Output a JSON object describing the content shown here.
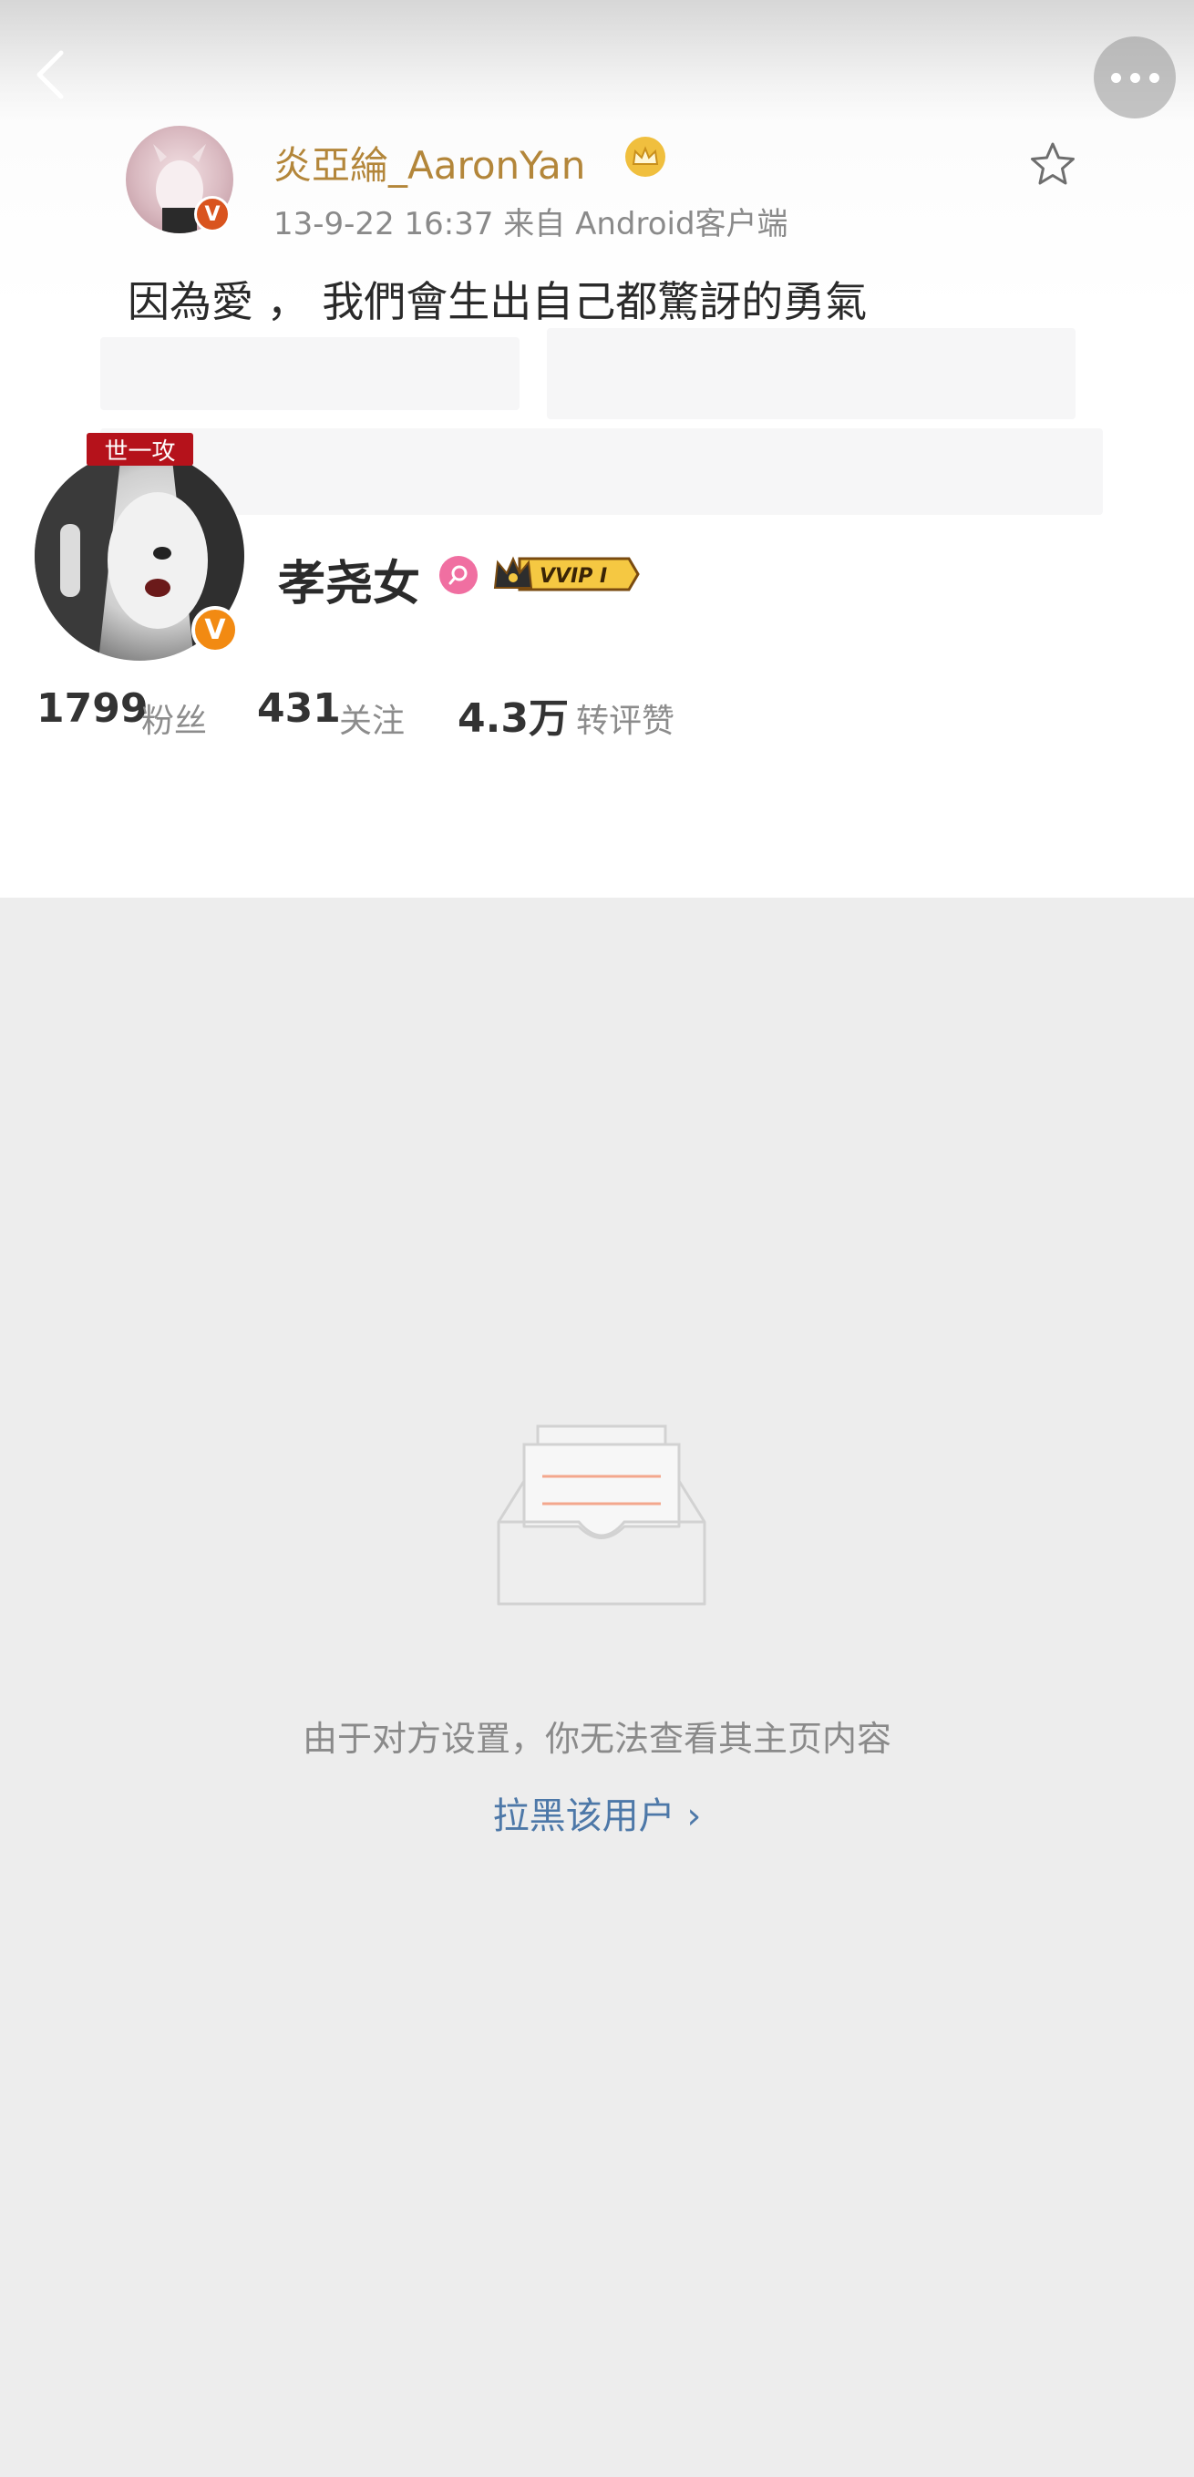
{
  "cover": {
    "quoted_post": {
      "username": "炎亞綸_AaronYan",
      "meta": "13-9-22 16:37  来自 Android客户端",
      "text": "因為愛 ， 我們會生出自己都驚訝的勇氣"
    }
  },
  "profile": {
    "avatar_badge": "世一攻",
    "name": "孝尧女",
    "vip_label": "VVIP I",
    "stats": [
      {
        "value": "1799",
        "label": "粉丝"
      },
      {
        "value": "431",
        "label": "关注"
      },
      {
        "value": "4.3万",
        "label": "转评赞"
      }
    ]
  },
  "empty_state": {
    "message": "由于对方设置，你无法查看其主页内容",
    "block_link": "拉黑该用户 ›"
  },
  "colors": {
    "background": "#ededed",
    "link": "#4d78a8",
    "verified_badge": "#f28a12",
    "avatar_badge": "#b5121b"
  },
  "icons": [
    "back-arrow-icon",
    "more-dots-icon",
    "star-icon",
    "crown-icon",
    "search-badge-icon",
    "vvip-crown-icon",
    "empty-box-icon",
    "verified-icon"
  ]
}
